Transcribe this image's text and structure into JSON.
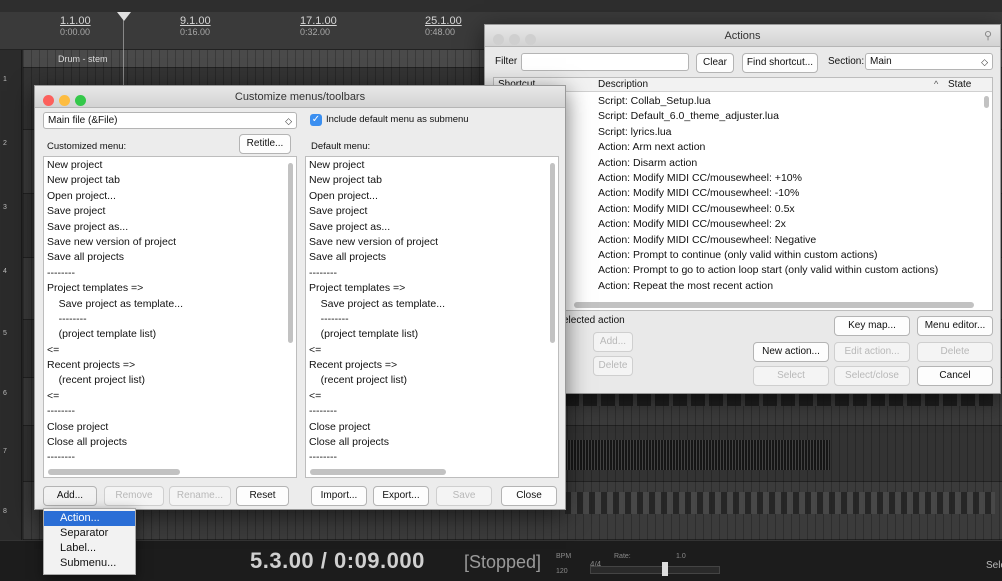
{
  "timeline": {
    "markers": [
      {
        "bar": "1.1.00",
        "time": "0:00.00"
      },
      {
        "bar": "9.1.00",
        "time": "0:16.00"
      },
      {
        "bar": "17.1.00",
        "time": "0:32.00"
      },
      {
        "bar": "25.1.00",
        "time": "0:48.00"
      }
    ],
    "track_label": "Drum - stem"
  },
  "track_numbers": [
    "1",
    "2",
    "3",
    "4",
    "5",
    "6",
    "7",
    "8"
  ],
  "transport": {
    "position": "5.3.00 / 0:09.000",
    "state": "[Stopped]",
    "bpm_label": "BPM",
    "bpm": "120",
    "timesig": "4/4",
    "rate_label": "Rate:",
    "rate": "1.0",
    "rate_fraction": 0.58,
    "right_text": "Sele"
  },
  "customize": {
    "title": "Customize menus/toolbars",
    "menu_select": "Main file (&File)",
    "include_default": "Include default menu as submenu",
    "customized_label": "Customized menu:",
    "retitle": "Retitle...",
    "default_label": "Default menu:",
    "customized_items": [
      "New project",
      "New project tab",
      "Open project...",
      "Save project",
      "Save project as...",
      "Save new version of project",
      "Save all projects",
      "--------",
      "Project templates =>",
      "    Save project as template...",
      "    --------",
      "    (project template list)",
      "<=",
      "Recent projects =>",
      "    (recent project list)",
      "<=",
      "--------",
      "Close project",
      "Close all projects",
      "--------"
    ],
    "default_items": [
      "New project",
      "New project tab",
      "Open project...",
      "Save project",
      "Save project as...",
      "Save new version of project",
      "Save all projects",
      "--------",
      "Project templates =>",
      "    Save project as template...",
      "    --------",
      "    (project template list)",
      "<=",
      "Recent projects =>",
      "    (recent project list)",
      "<=",
      "--------",
      "Close project",
      "Close all projects",
      "--------"
    ],
    "buttons": {
      "add": "Add...",
      "remove": "Remove",
      "rename": "Rename...",
      "reset": "Reset",
      "import": "Import...",
      "export": "Export...",
      "save": "Save",
      "close": "Close"
    }
  },
  "add_menu": [
    "Action...",
    "Separator",
    "Label...",
    "Submenu..."
  ],
  "actions": {
    "title": "Actions",
    "filter_label": "Filter",
    "clear": "Clear",
    "find_shortcut": "Find shortcut...",
    "section_label": "Section:",
    "section_value": "Main",
    "col_shortcut": "Shortcut",
    "col_description": "Description",
    "col_state": "State",
    "rows": [
      "Script: Collab_Setup.lua",
      "Script: Default_6.0_theme_adjuster.lua",
      "Script: lyrics.lua",
      "Action: Arm next action",
      "Action: Disarm action",
      "Action: Modify MIDI CC/mousewheel: +10%",
      "Action: Modify MIDI CC/mousewheel: -10%",
      "Action: Modify MIDI CC/mousewheel: 0.5x",
      "Action: Modify MIDI CC/mousewheel: 2x",
      "Action: Modify MIDI CC/mousewheel: Negative",
      "Action: Prompt to continue (only valid within custom actions)",
      "Action: Prompt to go to action loop start (only valid within custom actions)",
      "Action: Repeat the most recent action"
    ],
    "selected_label": "elected action",
    "add": "Add...",
    "delete_small": "Delete",
    "key_map": "Key map...",
    "menu_editor": "Menu editor...",
    "new_action": "New action...",
    "edit_action": "Edit action...",
    "delete": "Delete",
    "select": "Select",
    "select_close": "Select/close",
    "cancel": "Cancel"
  },
  "colors": {
    "close": "#fc605c",
    "minimize": "#fdbc40",
    "zoom": "#34c84a",
    "menu_highlight": "#2a6ed6",
    "checkbox": "#3b8ff0"
  }
}
